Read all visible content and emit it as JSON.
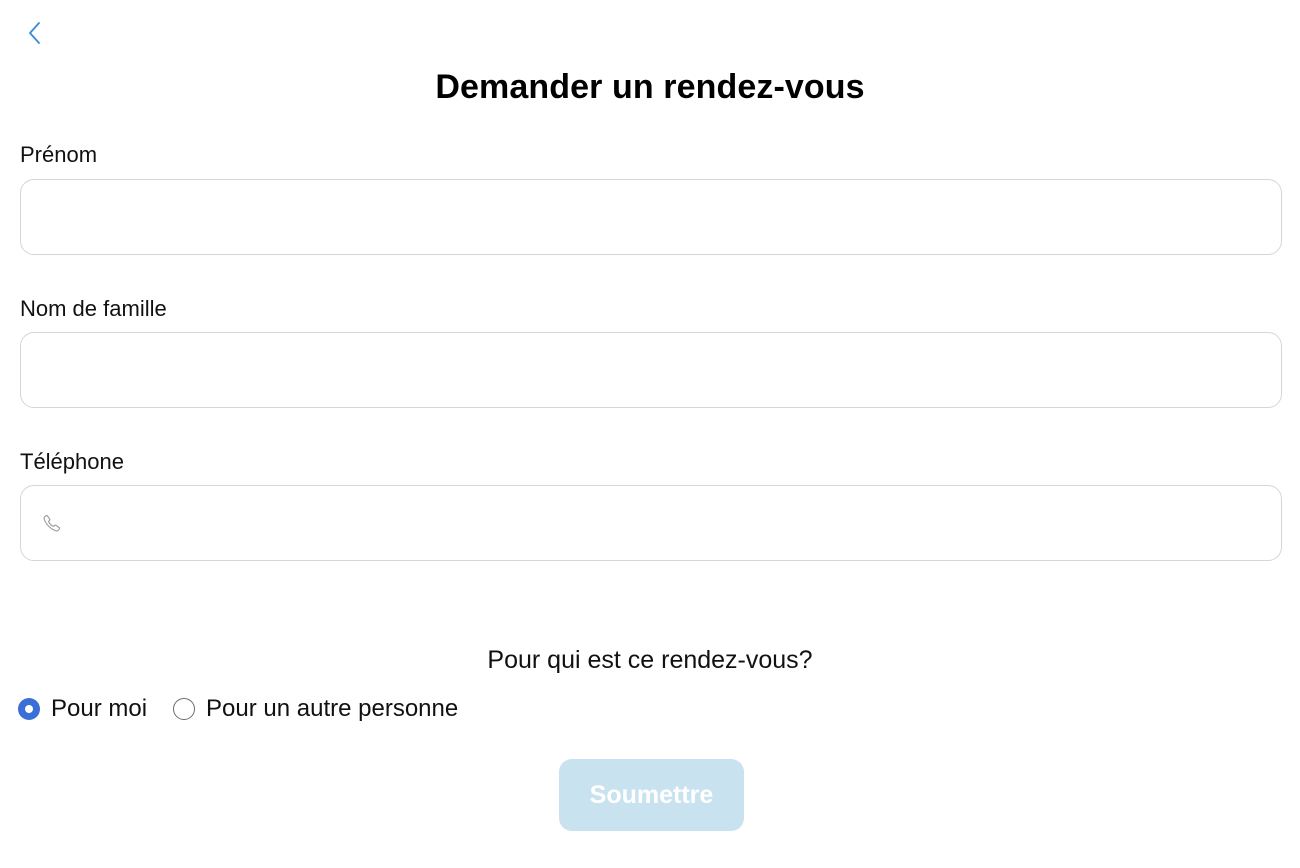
{
  "header": {
    "back_icon": "chevron-left-icon",
    "title": "Demander un rendez-vous"
  },
  "form": {
    "first_name": {
      "label": "Prénom",
      "value": "",
      "placeholder": ""
    },
    "last_name": {
      "label": "Nom de famille",
      "value": "",
      "placeholder": ""
    },
    "phone": {
      "label": "Téléphone",
      "value": "",
      "placeholder": "",
      "icon": "phone-icon"
    }
  },
  "appointment_for": {
    "question": "Pour qui est ce rendez-vous?",
    "options": [
      {
        "label": "Pour moi",
        "selected": true
      },
      {
        "label": "Pour un autre personne",
        "selected": false
      }
    ]
  },
  "submit": {
    "label": "Soumettre",
    "disabled": true
  },
  "colors": {
    "accent": "#3a8bd6",
    "radio_selected": "#3a6fd8",
    "submit_disabled_bg": "#c9e2f0",
    "border": "#d6d6d6"
  }
}
